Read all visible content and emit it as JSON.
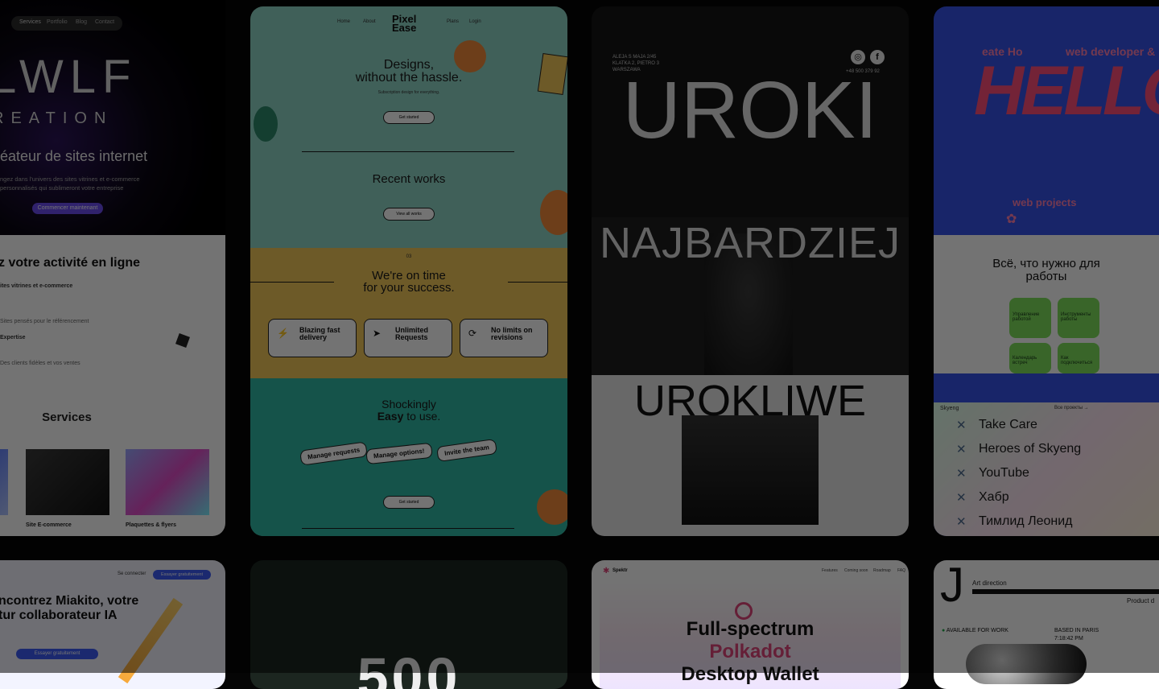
{
  "card1": {
    "nav": [
      "Services",
      "Portfolio",
      "Blog",
      "Contact"
    ],
    "logo_top": "LWLF",
    "logo_bottom": "REATION",
    "headline": "éateur de sites internet",
    "intro_line1": "ngez dans l'univers des sites vitrines et e-commerce",
    "intro_line2": "personnalisés qui sublimeront votre entreprise",
    "cta": "Commencer maintenant",
    "section_title": "z votre activité en ligne",
    "bullets": [
      "ites vitrines et e-commerce",
      "Sites pensés pour le référencement",
      "Expertise",
      "Des clients fidèles et vos ventes"
    ],
    "services_title": "Services",
    "service_labels": [
      "Site E-commerce",
      "Plaquettes & flyers"
    ]
  },
  "card2": {
    "nav": [
      "Home",
      "About",
      "Plans",
      "Login"
    ],
    "logo": "Pixel Ease",
    "hero_line1": "Designs,",
    "hero_line2": "without the hassle.",
    "hero_sub": "Subscription design for everything.",
    "hero_btn": "Get started",
    "recent_title": "Recent works",
    "recent_btn": "View all works",
    "yellow_num": "03",
    "time_line1": "We're on time",
    "time_line2": "for your success.",
    "features": [
      {
        "icon": "⚡",
        "title_a": "Blazing fast",
        "title_b": "delivery"
      },
      {
        "icon": "➤",
        "title_a": "Unlimited",
        "title_b": "Requests"
      },
      {
        "icon": "⟳",
        "title_a": "No limits on",
        "title_b": "revisions"
      }
    ],
    "easy_line1": "Shockingly",
    "easy_bold": "Easy",
    "easy_rest": " to use.",
    "tags": [
      "Manage requests",
      "Manage options!",
      "Invite the team"
    ],
    "bottom_btn": "Get started"
  },
  "card3": {
    "address_line1": "ALEJA S MAJA 2/45",
    "address_line2": "KLATKA 2, PIETRO 3",
    "address_line3": "WARSZAWA",
    "phone": "+48 500 379 92",
    "title_top": "UROKI",
    "title_mid": "NAJBARDZIEJ",
    "title_bottom": "UROKLIWE"
  },
  "card4": {
    "top_text_left": "eate Ho",
    "top_text_right": "web developer &",
    "big_word": "HELLO",
    "web_projects": "web projects",
    "heading_line1": "Всё, что нужно для",
    "heading_line2": "работы",
    "tiles": [
      "Управление работой",
      "Инструменты работы",
      "Календарь встреч",
      "Как подключиться"
    ],
    "brand": "Skyeng",
    "links_header": "Все проекты →",
    "list": [
      "Take Care",
      "Heroes of Skyeng",
      "YouTube",
      "Хабр",
      "Тимлид Леонид"
    ]
  },
  "card5": {
    "top_link": "Se connecter",
    "top_btn": "Essayer gratuitement",
    "title_line1": "ncontrez Miakito, votre",
    "title_line2": "tur collaborateur IA",
    "cta": "Essayer gratuitement"
  },
  "card6": {
    "big_text": "500"
  },
  "card7": {
    "brand": "Spektr",
    "nav": [
      "Features",
      "Coming soon",
      "Roadmap",
      "FAQ"
    ],
    "title_line1": "Full-spectrum",
    "title_line2": "Polkadot",
    "title_line3": "Desktop Wallet"
  },
  "card8": {
    "logo": "J",
    "art_direction": "Art direction",
    "product": "Product d",
    "available": "AVAILABLE FOR WORK",
    "based": "BASED IN PARIS",
    "time": "7:18:42 PM"
  },
  "colors": {
    "teal": "#8fd4c5",
    "yellow": "#f2c75a",
    "orange": "#f28a3a",
    "blue": "#3552e8",
    "pink": "#ff4f7b",
    "green": "#7ee05c",
    "purple": "#6a4cf0"
  }
}
